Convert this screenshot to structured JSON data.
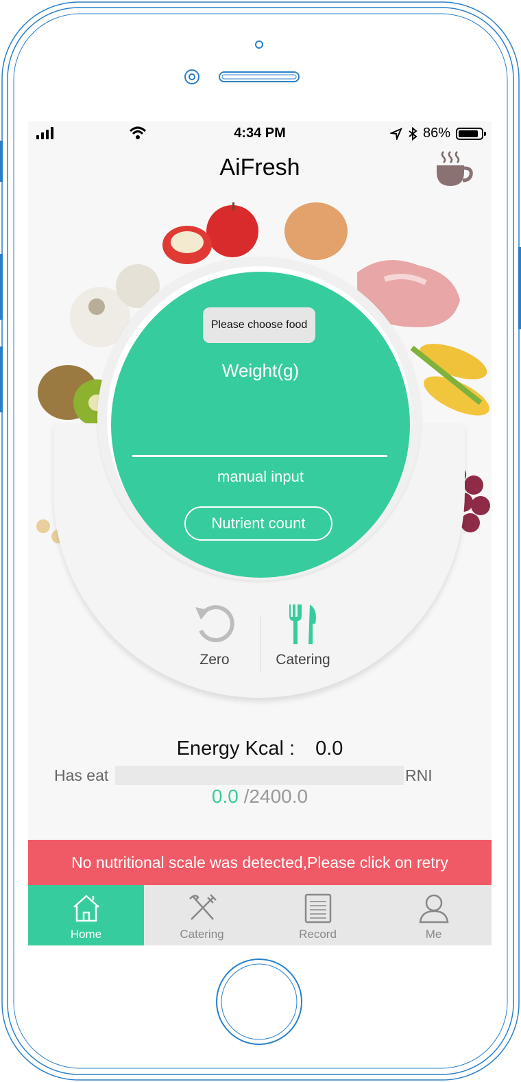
{
  "status_bar": {
    "time": "4:34 PM",
    "battery": "86%",
    "battery_level": 0.86
  },
  "header": {
    "title": "AiFresh",
    "icon": "coffee-cup-icon"
  },
  "scale": {
    "choose_food": "Please choose food",
    "weight_label": "Weight(g)",
    "weight_value": "",
    "manual_input": "manual input",
    "nutrient_count": "Nutrient count"
  },
  "actions": {
    "zero": "Zero",
    "catering": "Catering"
  },
  "energy": {
    "label": "Energy Kcal :",
    "value": "0.0",
    "has_eat": "Has eat",
    "rni": "RNI",
    "eaten": "0.0",
    "target": "/2400.0",
    "progress": 0.0
  },
  "alert": {
    "message": "No nutritional scale was detected,Please click on retry"
  },
  "tabs": [
    {
      "label": "Home",
      "icon": "home-icon",
      "active": true
    },
    {
      "label": "Catering",
      "icon": "fork-knife-icon",
      "active": false
    },
    {
      "label": "Record",
      "icon": "record-list-icon",
      "active": false
    },
    {
      "label": "Me",
      "icon": "user-icon",
      "active": false
    }
  ],
  "colors": {
    "accent": "#37cc9e",
    "alert": "#f05a66",
    "frame": "#2a7fc9"
  }
}
